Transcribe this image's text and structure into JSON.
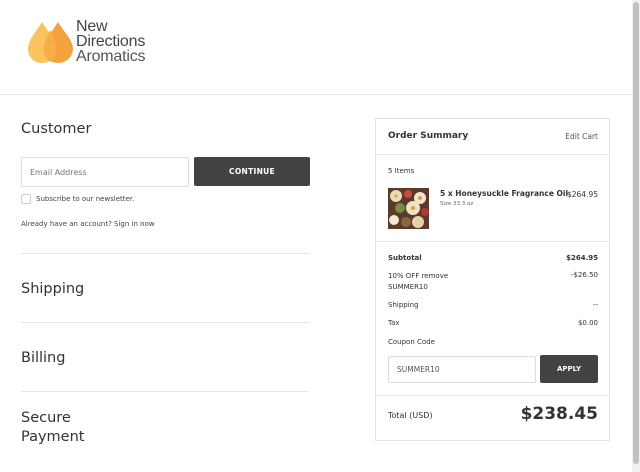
{
  "brand": {
    "line1": "New",
    "line2": "Directions",
    "line3": "Aromatics",
    "colors": {
      "drop_light": "#F9C35F",
      "drop_dark": "#F29A2E",
      "drop_mid": "#F5AE45"
    }
  },
  "customer": {
    "title": "Customer",
    "email_placeholder": "Email Address",
    "continue_label": "CONTINUE",
    "newsletter_label": "Subscribe to our newsletter.",
    "signin_text": "Already have an account? Sign in now",
    "newsletter_checked": false
  },
  "sections": {
    "shipping": "Shipping",
    "billing": "Billing",
    "payment": "Secure Payment"
  },
  "summary": {
    "title": "Order Summary",
    "edit_cart": "Edit Cart",
    "items_count": "5 Items",
    "product": {
      "name": "5 x Honeysuckle Fragrance Oil",
      "size": "Size 33.3 oz",
      "price": "$264.95"
    },
    "subtotal_label": "Subtotal",
    "subtotal_value": "$264.95",
    "discount_label": "10% OFF remove SUMMER10",
    "discount_value": "-$26.50",
    "shipping_label": "Shipping",
    "shipping_value": "--",
    "tax_label": "Tax",
    "tax_value": "$0.00",
    "coupon_label": "Coupon Code",
    "coupon_value": "SUMMER10",
    "apply_label": "APPLY",
    "total_label": "Total (USD)",
    "total_value": "$238.45"
  },
  "theme": {
    "button_bg": "#434343",
    "border": "#e6e6e6"
  }
}
